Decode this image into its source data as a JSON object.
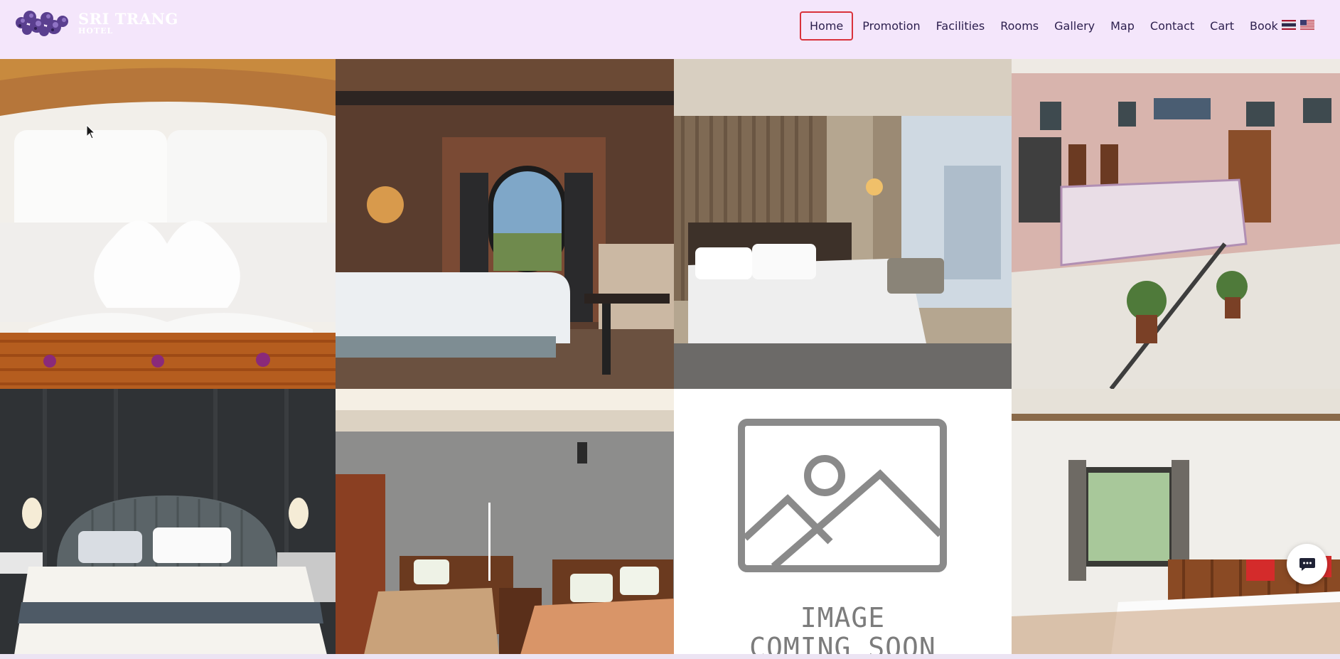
{
  "brand": {
    "name": "SRI TRANG",
    "subtitle": "HOTEL"
  },
  "nav": {
    "items": [
      {
        "label": "Home",
        "active": true
      },
      {
        "label": "Promotion"
      },
      {
        "label": "Facilities"
      },
      {
        "label": "Rooms"
      },
      {
        "label": "Gallery"
      },
      {
        "label": "Map"
      },
      {
        "label": "Contact"
      },
      {
        "label": "Cart"
      },
      {
        "label": "Book"
      }
    ]
  },
  "languages": [
    "thai-flag-icon",
    "us-flag-icon"
  ],
  "gallery": {
    "placeholder": {
      "line1": "IMAGE",
      "line2": "COMING SOON"
    }
  },
  "colors": {
    "active_border": "#d9323b",
    "nav_text": "#2b1e4d",
    "header_bg": "#f4e6fb"
  },
  "chat": {
    "icon": "chat-bubble-icon"
  }
}
